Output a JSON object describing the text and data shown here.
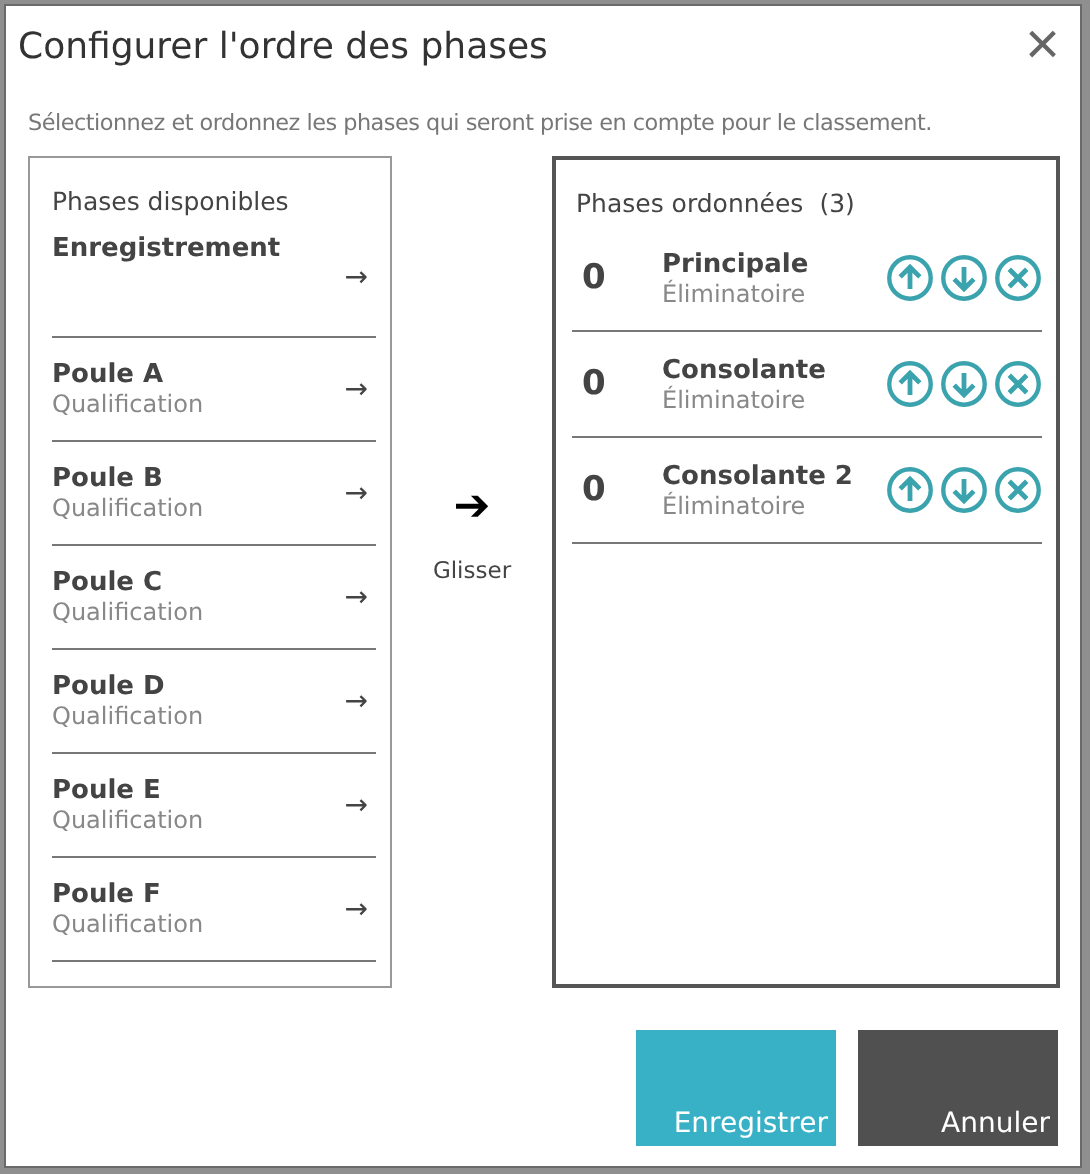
{
  "dialog": {
    "title": "Configurer l'ordre des phases",
    "close": "×",
    "instructions": "Sélectionnez et ordonnez les phases qui seront prise en compte pour le classement."
  },
  "available": {
    "title": "Phases disponibles",
    "items": [
      {
        "name": "Enregistrement",
        "arrow": "→"
      },
      {
        "name": "Poule A",
        "type": "Qualification",
        "arrow": "→"
      },
      {
        "name": "Poule B",
        "type": "Qualification",
        "arrow": "→"
      },
      {
        "name": "Poule C",
        "type": "Qualification",
        "arrow": "→"
      },
      {
        "name": "Poule D",
        "type": "Qualification",
        "arrow": "→"
      },
      {
        "name": "Poule E",
        "type": "Qualification",
        "arrow": "→"
      },
      {
        "name": "Poule F",
        "type": "Qualification",
        "arrow": "→"
      }
    ]
  },
  "drag_hint": {
    "arrow": "➔",
    "label": "Glisser"
  },
  "ordered": {
    "title": "Phases ordonnées",
    "count": "(3)",
    "items": [
      {
        "number": "0",
        "name": "Principale",
        "type": "Éliminatoire"
      },
      {
        "number": "0",
        "name": "Consolante",
        "type": "Éliminatoire"
      },
      {
        "number": "0",
        "name": "Consolante 2",
        "type": "Éliminatoire"
      }
    ]
  },
  "buttons": [
    {
      "label": "Enregistrer",
      "kind": "primary"
    },
    {
      "label": "Annuler",
      "kind": "secondary"
    }
  ]
}
